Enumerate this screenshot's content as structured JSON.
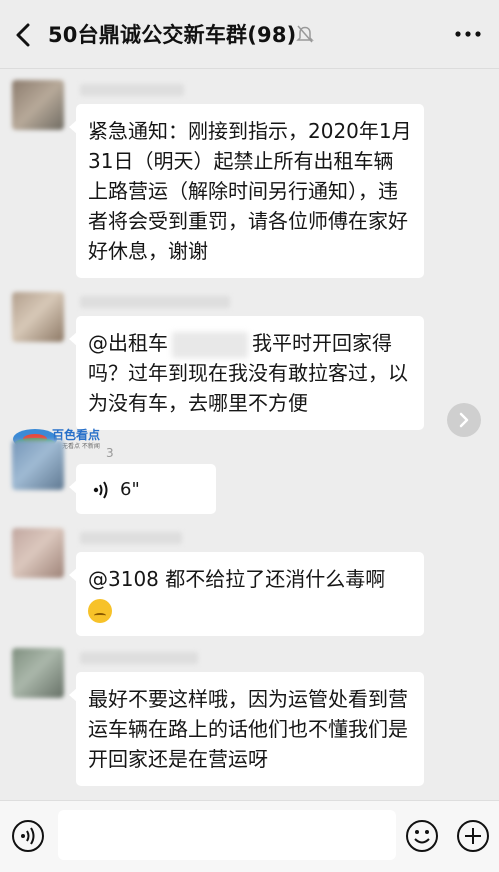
{
  "header": {
    "title": "50台鼎诚公交新车群(98)",
    "back_icon": "chevron-left-icon",
    "mute_icon": "bell-off-icon",
    "more_icon": "ellipsis-icon"
  },
  "messages": [
    {
      "type": "text",
      "text": "紧急通知：刚接到指示，2020年1月31日（明天）起禁止所有出租车辆上路营运（解除时间另行通知），违者将会受到重罚，请各位师傅在家好好休息，谢谢"
    },
    {
      "type": "text",
      "prefix": "@出租车",
      "text": "我平时开回家得吗？过年到现在我没有敢拉客过，以为没有车，去哪里不方便"
    },
    {
      "type": "voice",
      "duration": "6\"",
      "sender_fragment": "3",
      "icon": "voice-wave-icon"
    },
    {
      "type": "text",
      "text": "@3108 都不给拉了还消什么毒啊",
      "emoji": "thinking-face-icon"
    },
    {
      "type": "text",
      "text": "最好不要这样哦，因为运管处看到营运车辆在路上的话他们也不懂我们是开回家还是在营运呀"
    }
  ],
  "watermark": {
    "title": "百色看点",
    "subtitle": "无看点 不新闻"
  },
  "footer": {
    "voice_icon": "voice-toggle-icon",
    "emoji_icon": "emoji-icon",
    "plus_icon": "plus-icon",
    "input_placeholder": ""
  },
  "colors": {
    "background": "#ededed",
    "bubble": "#ffffff",
    "header": "#ededed",
    "footer": "#f7f7f7"
  }
}
